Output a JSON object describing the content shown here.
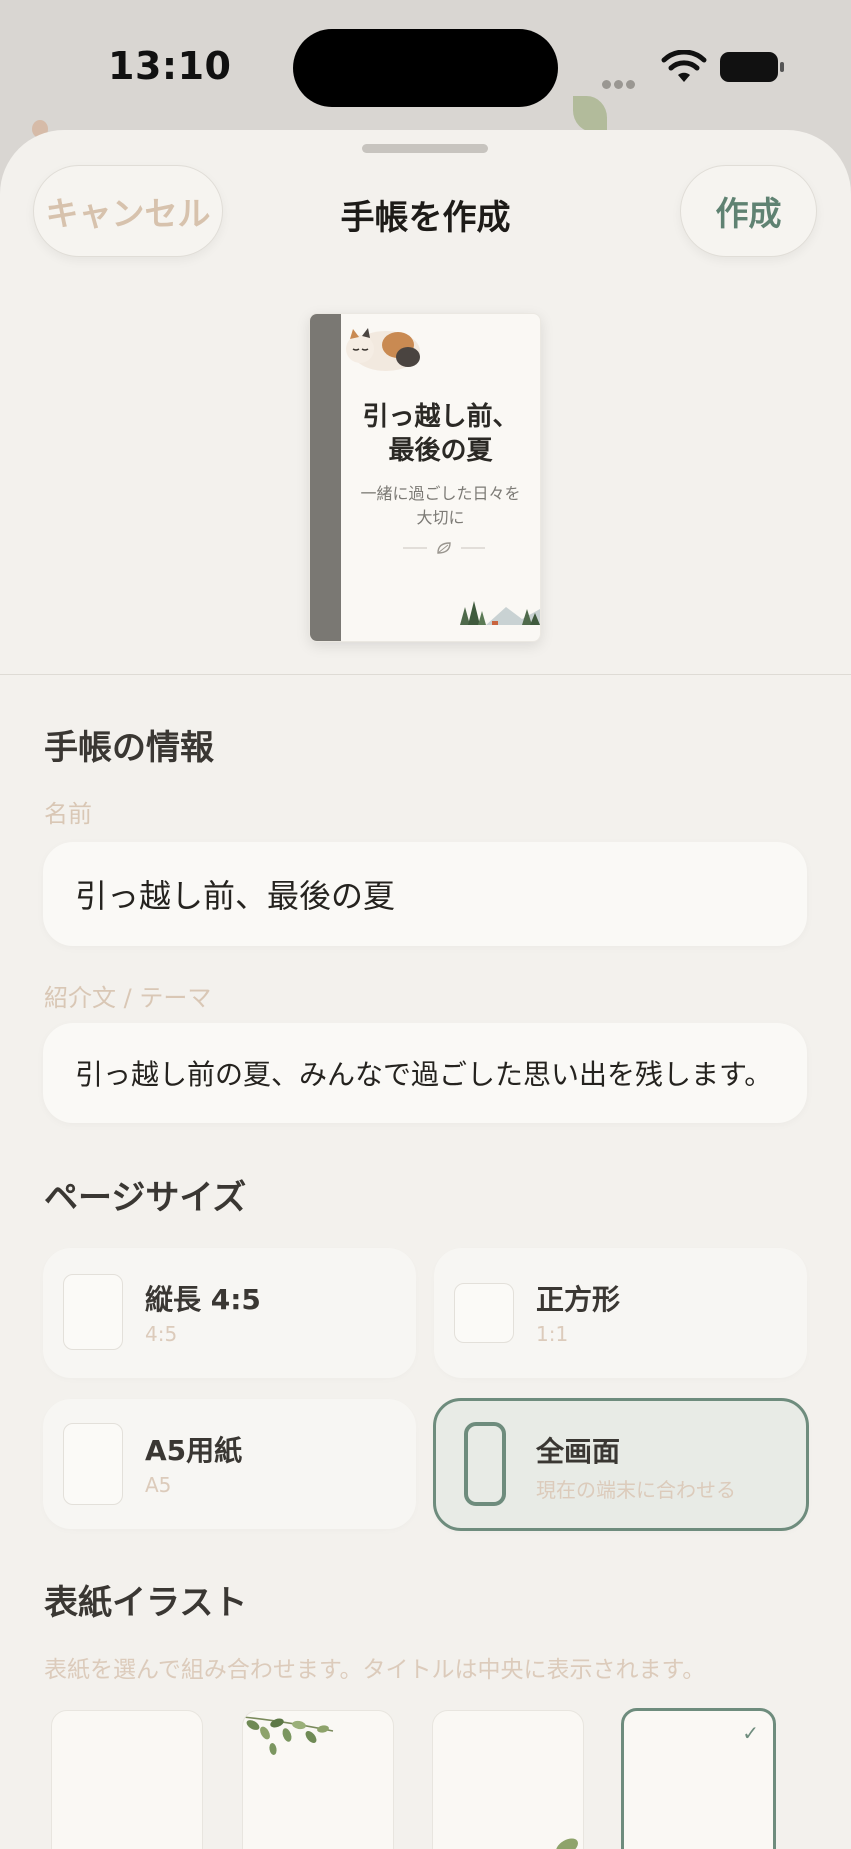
{
  "status_bar": {
    "time": "13:10"
  },
  "nav": {
    "cancel_label": "キャンセル",
    "title": "手帳を作成",
    "create_label": "作成"
  },
  "preview": {
    "title_line1": "引っ越し前、",
    "title_line2": "最後の夏",
    "subtitle_line1": "一緒に過ごした日々を",
    "subtitle_line2": "大切に"
  },
  "info_section": {
    "heading": "手帳の情報",
    "name_label": "名前",
    "name_value": "引っ越し前、最後の夏",
    "desc_label": "紹介文 / テーマ",
    "desc_value": "引っ越し前の夏、みんなで過ごした思い出を残します。"
  },
  "page_size_section": {
    "heading": "ページサイズ",
    "options": [
      {
        "name": "縦長 4:5",
        "ratio": "4:5",
        "selected": false
      },
      {
        "name": "正方形",
        "ratio": "1:1",
        "selected": false
      },
      {
        "name": "A5用紙",
        "ratio": "A5",
        "selected": false
      },
      {
        "name": "全画面",
        "ratio": "現在の端末に合わせる",
        "selected": true
      }
    ]
  },
  "cover_section": {
    "heading": "表紙イラスト",
    "hint": "表紙を選んで組み合わせます。タイトルは中央に表示されます。",
    "selected_index": 3,
    "check_mark": "✓"
  },
  "colors": {
    "accent": "#6e8c7d",
    "sheet_bg": "#f3f1ed",
    "muted_label": "#d9c7b5"
  }
}
